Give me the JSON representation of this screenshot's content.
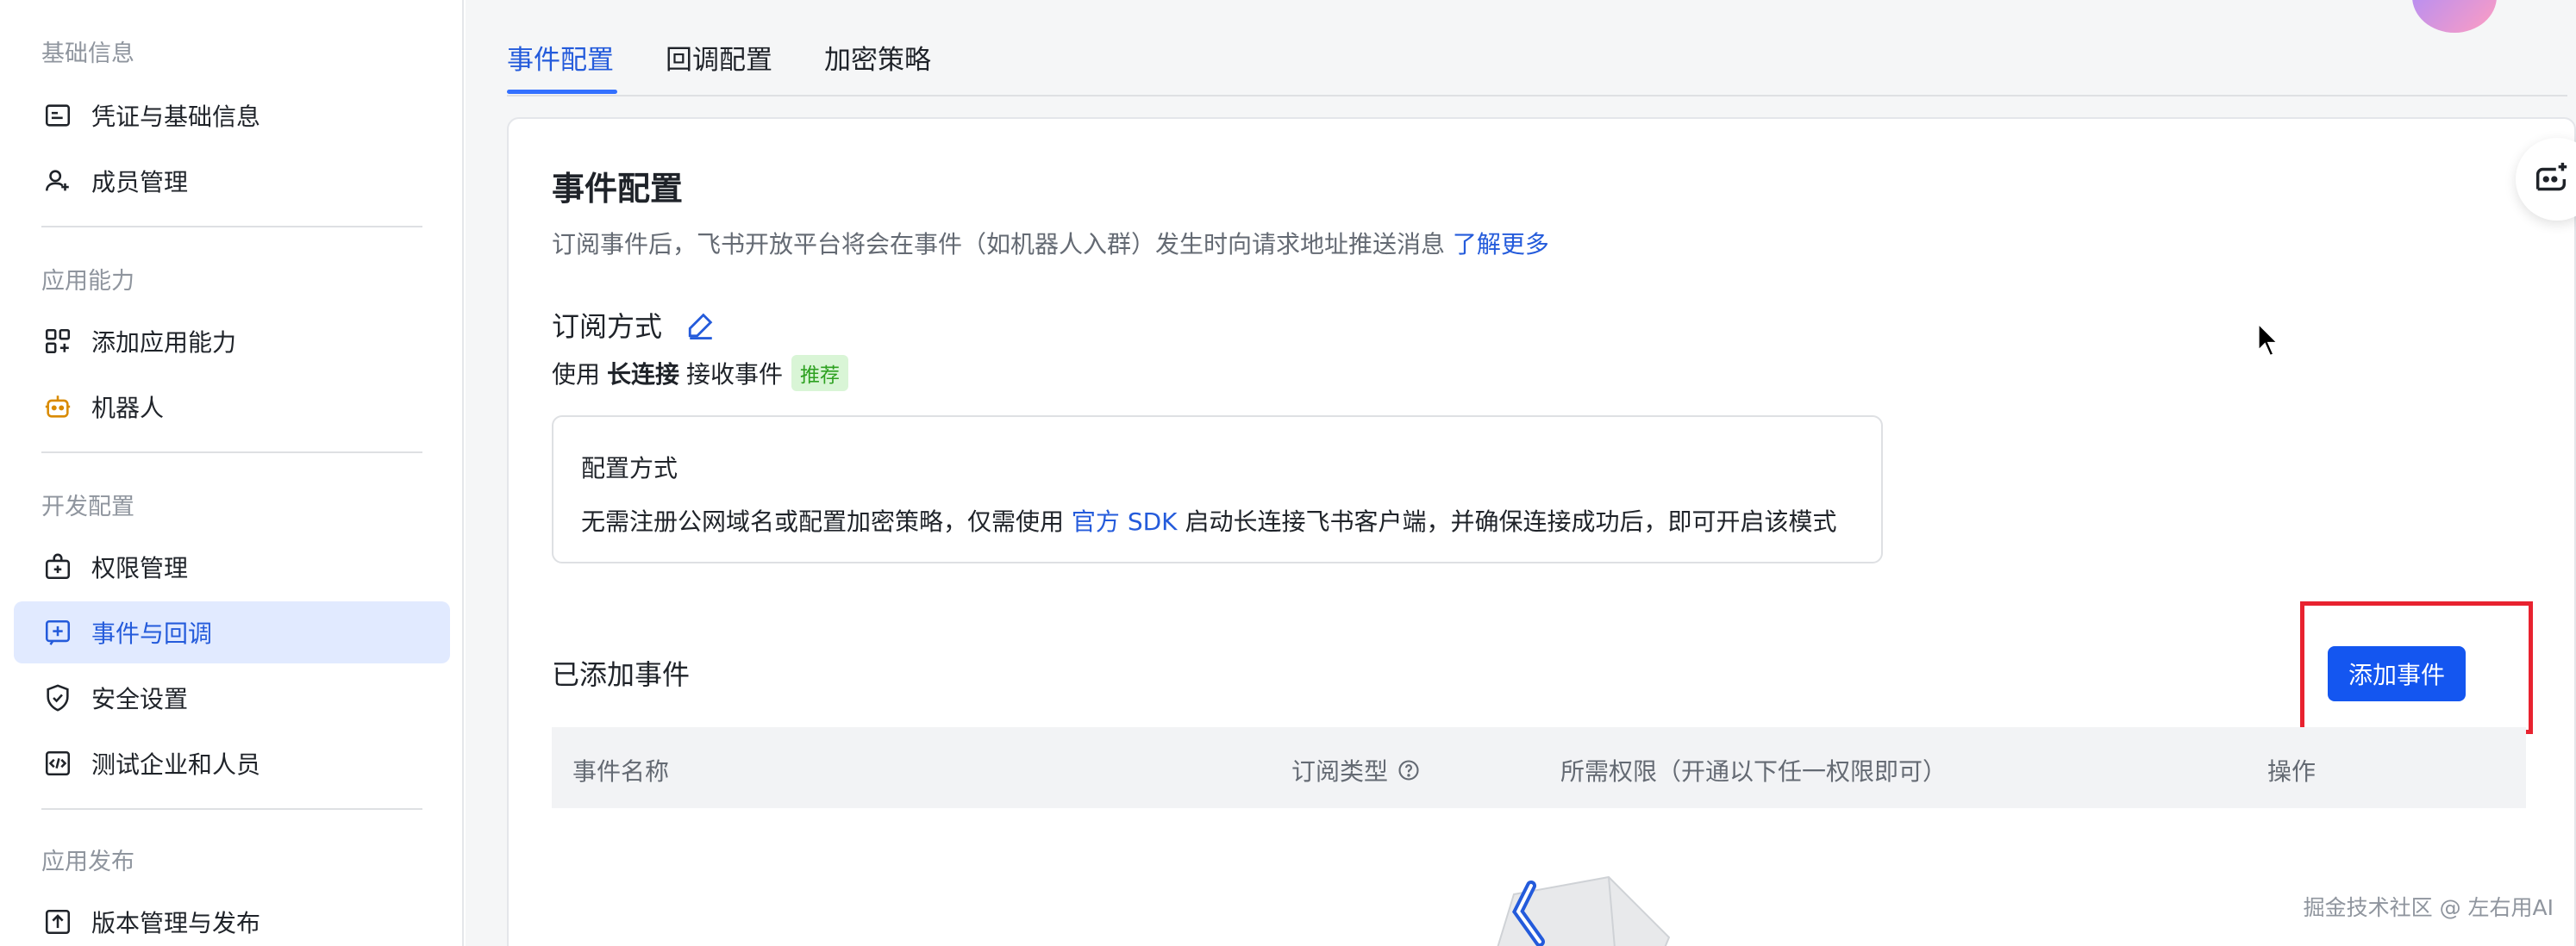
{
  "sidebar": {
    "groups": [
      {
        "title": "基础信息"
      },
      {
        "title": "应用能力"
      },
      {
        "title": "开发配置"
      },
      {
        "title": "应用发布"
      }
    ],
    "items": [
      {
        "label": "凭证与基础信息",
        "icon": "credential-icon"
      },
      {
        "label": "成员管理",
        "icon": "user-add-icon"
      },
      {
        "label": "添加应用能力",
        "icon": "apps-add-icon"
      },
      {
        "label": "机器人",
        "icon": "robot-icon"
      },
      {
        "label": "权限管理",
        "icon": "permission-icon"
      },
      {
        "label": "事件与回调",
        "icon": "event-icon"
      },
      {
        "label": "安全设置",
        "icon": "shield-icon"
      },
      {
        "label": "测试企业和人员",
        "icon": "code-icon"
      },
      {
        "label": "版本管理与发布",
        "icon": "upload-icon"
      }
    ]
  },
  "tabs": [
    {
      "label": "事件配置"
    },
    {
      "label": "回调配置"
    },
    {
      "label": "加密策略"
    }
  ],
  "content": {
    "title": "事件配置",
    "description": "订阅事件后，飞书开放平台将会在事件（如机器人入群）发生时向请求地址推送消息",
    "learn_more": "了解更多",
    "subscription": {
      "title": "订阅方式",
      "line_prefix": "使用",
      "line_bold": "长连接",
      "line_suffix": "接收事件",
      "badge": "推荐"
    },
    "config_box": {
      "title": "配置方式",
      "desc_prefix": "无需注册公网域名或配置加密策略，仅需使用",
      "desc_link": "官方 SDK",
      "desc_suffix": "启动长连接飞书客户端，并确保连接成功后，即可开启该模式"
    },
    "added_events": {
      "title": "已添加事件",
      "add_button": "添加事件"
    },
    "table": {
      "columns": [
        "事件名称",
        "订阅类型",
        "所需权限（开通以下任一权限即可）",
        "操作"
      ]
    }
  },
  "watermark": "掘金技术社区 @ 左右用AI",
  "colors": {
    "accent": "#245bdb",
    "button": "#1456f0",
    "highlight": "#e8222f",
    "badge_bg": "#d9f5d6",
    "badge_text": "#2ea121"
  }
}
